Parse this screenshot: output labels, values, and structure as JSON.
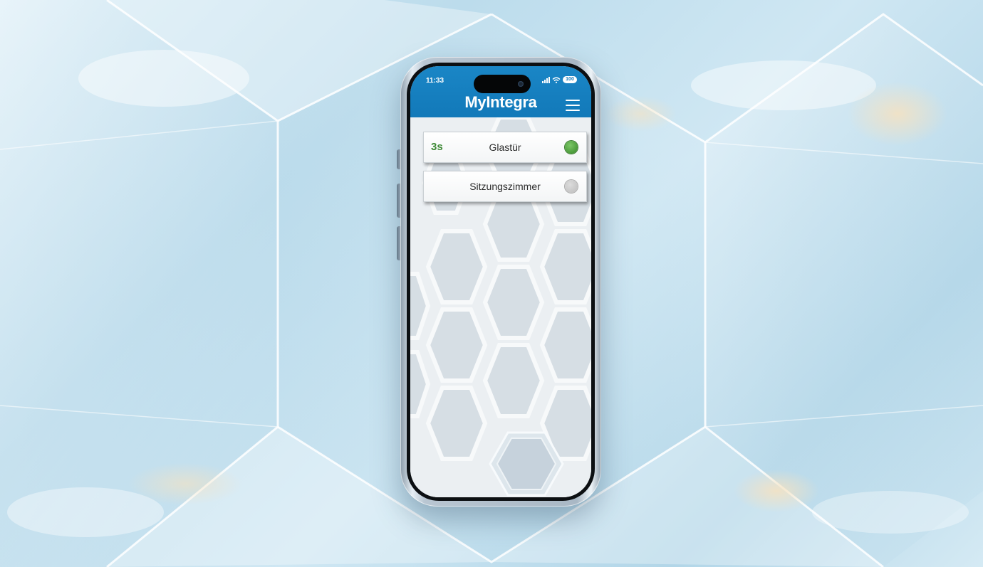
{
  "status_bar": {
    "time": "11:33",
    "battery": "100"
  },
  "header": {
    "title": "MyIntegra",
    "menu_icon": "hamburger-menu-icon"
  },
  "doors": [
    {
      "timer": "3s",
      "label": "Glastür",
      "status": "active",
      "status_color": "#4a9a3a"
    },
    {
      "timer": "",
      "label": "Sitzungszimmer",
      "status": "inactive",
      "status_color": "#c4c4c4"
    }
  ],
  "colors": {
    "header": "#1279b9",
    "timer": "#3f8a36"
  }
}
